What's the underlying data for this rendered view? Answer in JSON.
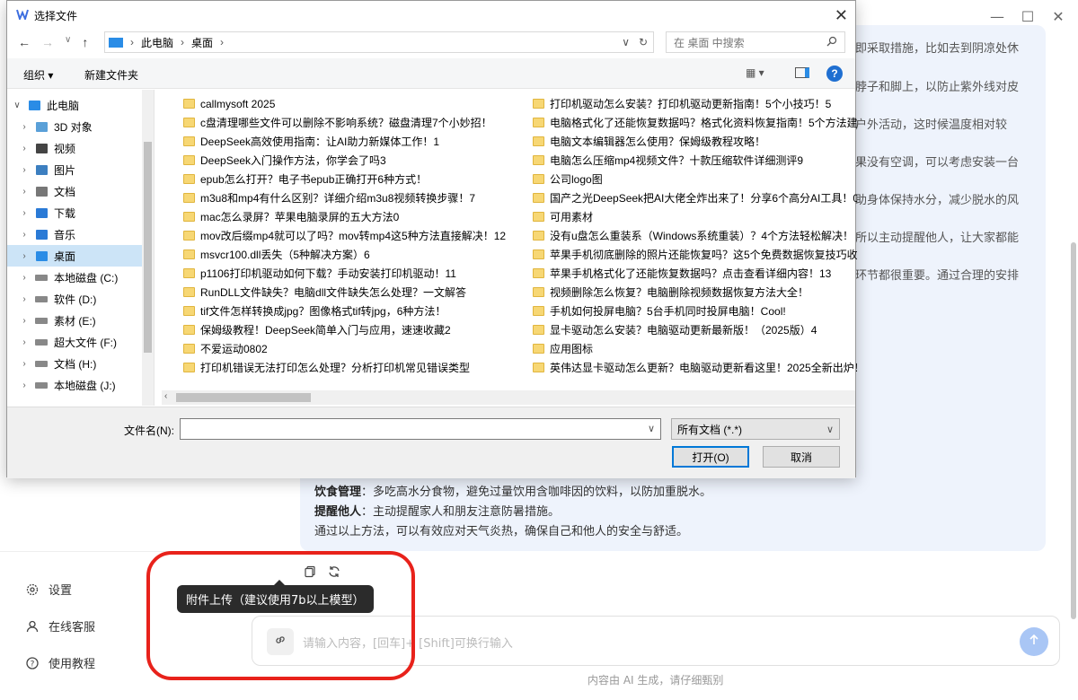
{
  "app": {
    "answer_fragments": [
      "即采取措施，比如去到阴凉处休",
      "脖子和脚上，以防止紫外线对皮",
      "户外活动，这时候温度相对较",
      "果没有空调，可以考虑安装一台",
      "助身体保持水分，减少脱水的风",
      "所以主动提醒他人，让大家都能",
      "环节都很重要。通过合理的安排"
    ],
    "answer_bottom": [
      {
        "label": "饮食管理",
        "text": "：多吃高水分食物，避免过量饮用含咖啡因的饮料，以防加重脱水。"
      },
      {
        "label": "提醒他人",
        "text": "：主动提醒家人和朋友注意防暑措施。"
      },
      {
        "label": "",
        "text": "通过以上方法，可以有效应对天气炎热，确保自己和他人的安全与舒适。"
      }
    ],
    "sidebar": {
      "items": [
        {
          "label": "设置",
          "icon": "gear-icon"
        },
        {
          "label": "在线客服",
          "icon": "user-icon"
        },
        {
          "label": "使用教程",
          "icon": "help-icon"
        }
      ]
    },
    "tooltip": "附件上传（建议使用7b以上模型）",
    "input_placeholder": "请输入内容，[回车]+ [Shift]可换行输入",
    "footer_note": "内容由 AI 生成，请仔细甄别",
    "colors": {
      "accent": "#a9c6f5",
      "highlight": "#e8221b",
      "answer_bg": "#eef3fc"
    }
  },
  "dialog": {
    "title": "选择文件",
    "path": [
      "此电脑",
      "桌面"
    ],
    "search_placeholder": "在 桌面 中搜索",
    "toolbar": {
      "organize": "组织 ▾",
      "new_folder": "新建文件夹"
    },
    "nav": [
      {
        "label": "此电脑",
        "level": 0,
        "expanded": true
      },
      {
        "label": "3D 对象",
        "level": 1
      },
      {
        "label": "视频",
        "level": 1
      },
      {
        "label": "图片",
        "level": 1
      },
      {
        "label": "文档",
        "level": 1
      },
      {
        "label": "下载",
        "level": 1
      },
      {
        "label": "音乐",
        "level": 1
      },
      {
        "label": "桌面",
        "level": 1,
        "selected": true
      },
      {
        "label": "本地磁盘 (C:)",
        "level": 1
      },
      {
        "label": "软件 (D:)",
        "level": 1
      },
      {
        "label": "素材 (E:)",
        "level": 1
      },
      {
        "label": "超大文件 (F:)",
        "level": 1
      },
      {
        "label": "文档 (H:)",
        "level": 1
      },
      {
        "label": "本地磁盘 (J:)",
        "level": 1
      }
    ],
    "files_left": [
      "callmysoft 2025",
      "c盘清理哪些文件可以删除不影响系统？磁盘清理7个小妙招！",
      "DeepSeek高效使用指南：让AI助力新媒体工作！1",
      "DeepSeek入门操作方法，你学会了吗3",
      "epub怎么打开？电子书epub正确打开6种方式！",
      "m3u8和mp4有什么区别？详细介绍m3u8视频转换步骤！7",
      "mac怎么录屏？苹果电脑录屏的五大方法0",
      "mov改后缀mp4就可以了吗？mov转mp4这5种方法直接解决！12",
      "msvcr100.dll丢失（5种解决方案）6",
      "p1106打印机驱动如何下载？手动安装打印机驱动！11",
      "RunDLL文件缺失？电脑dll文件缺失怎么处理？一文解答",
      "tif文件怎样转换成jpg？图像格式tif转jpg，6种方法！",
      "保姆级教程！DeepSeek简单入门与应用，速速收藏2",
      "不爱运动0802",
      "打印机错误无法打印怎么处理？分析打印机常见错误类型"
    ],
    "files_right": [
      "打印机驱动怎么安装？打印机驱动更新指南！5个小技巧！5",
      "电脑格式化了还能恢复数据吗？格式化资料恢复指南！5个方法建议",
      "电脑文本编辑器怎么使用？保姆级教程攻略！",
      "电脑怎么压缩mp4视频文件？十款压缩软件详细测评9",
      "公司logo图",
      "国产之光DeepSeek把AI大佬全炸出来了！分享6个高分AI工具！0",
      "可用素材",
      "没有u盘怎么重装系（Windows系统重装）？4个方法轻松解决！",
      "苹果手机彻底删除的照片还能恢复吗？这5个免费数据恢复技巧收好",
      "苹果手机格式化了还能恢复数据吗？点击查看详细内容！13",
      "视频删除怎么恢复？电脑删除视频数据恢复方法大全！",
      "手机如何投屏电脑？5台手机同时投屏电脑！Cool!",
      "显卡驱动怎么安装？电脑驱动更新最新版！（2025版）4",
      "应用图标",
      "英伟达显卡驱动怎么更新？电脑驱动更新看这里！2025全新出炉！"
    ],
    "filename_label": "文件名(N):",
    "filename_value": "",
    "filetype": "所有文档 (*.*)",
    "open_button": "打开(O)",
    "cancel_button": "取消"
  }
}
